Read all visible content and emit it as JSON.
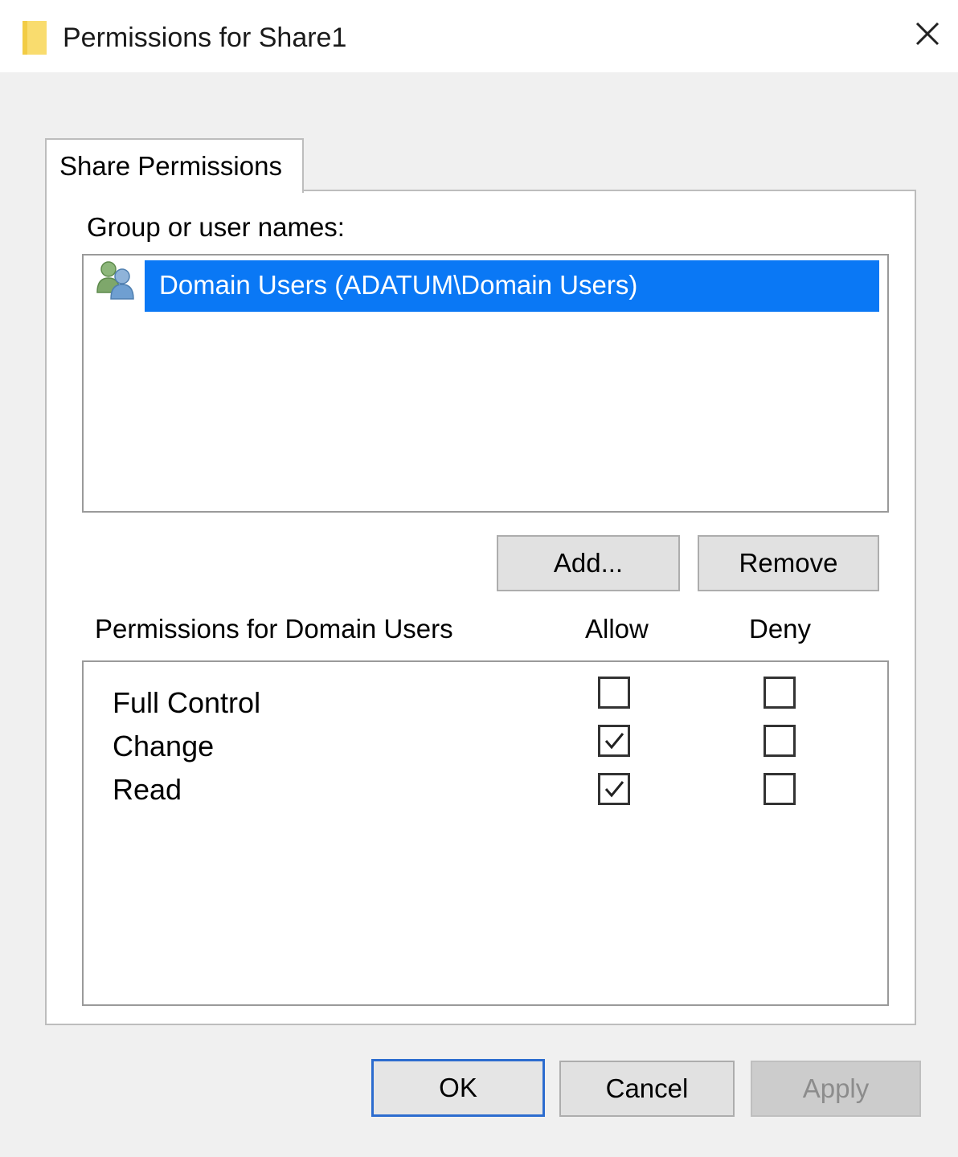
{
  "window": {
    "title": "Permissions for Share1",
    "close_icon": "close-icon"
  },
  "tabs": [
    {
      "label": "Share Permissions",
      "selected": true
    }
  ],
  "group_section": {
    "label": "Group or user names:",
    "items": [
      {
        "label": "Domain Users (ADATUM\\Domain Users)",
        "icon": "users-group-icon",
        "selected": true
      }
    ],
    "add_label": "Add...",
    "remove_label": "Remove"
  },
  "permissions_section": {
    "header": "Permissions for Domain Users",
    "allow_label": "Allow",
    "deny_label": "Deny",
    "rows": [
      {
        "name": "Full Control",
        "allow": false,
        "deny": false
      },
      {
        "name": "Change",
        "allow": true,
        "deny": false
      },
      {
        "name": "Read",
        "allow": true,
        "deny": false
      }
    ]
  },
  "footer": {
    "ok_label": "OK",
    "cancel_label": "Cancel",
    "apply_label": "Apply",
    "apply_enabled": false
  },
  "colors": {
    "selection": "#0a78f5",
    "ok_border": "#2c6ccf"
  }
}
